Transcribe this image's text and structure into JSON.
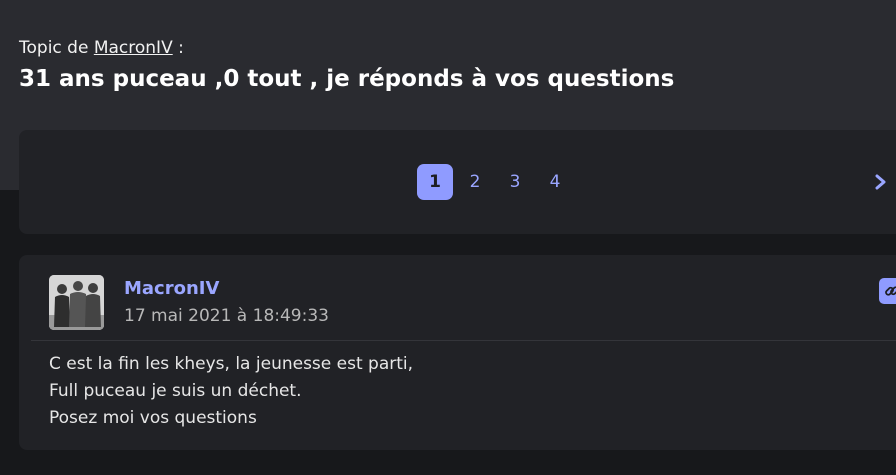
{
  "topic": {
    "prefix": "Topic de ",
    "author": "MacronIV",
    "suffix": " :",
    "title": "31 ans puceau ,0 tout , je réponds à vos questions"
  },
  "pagination": {
    "pages": [
      "1",
      "2",
      "3",
      "4"
    ],
    "current": "1",
    "next_icon": "chevron-right-icon"
  },
  "post": {
    "author": "MacronIV",
    "date": "17 mai 2021 à 18:49:33",
    "link_icon": "link-icon",
    "lines": [
      "C est la fin les kheys, la jeunesse est parti,",
      "Full puceau je suis un déchet.",
      "Posez moi vos questions"
    ]
  },
  "colors": {
    "accent": "#8f9bff",
    "background": "#17181b",
    "header": "#2a2b30",
    "card": "#212226"
  }
}
